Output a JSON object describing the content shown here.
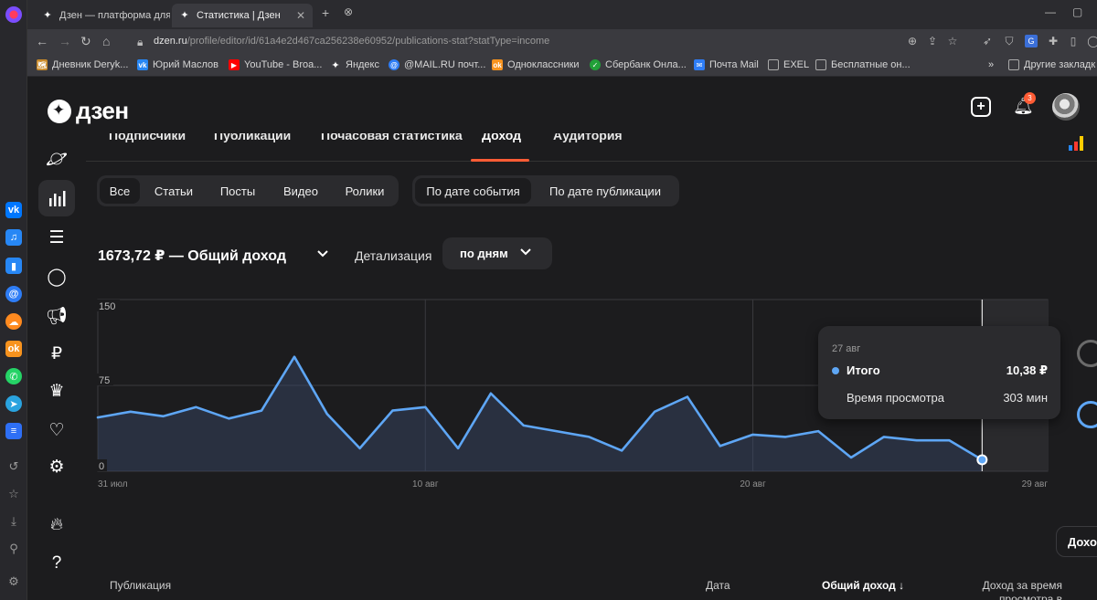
{
  "browser": {
    "tabs": [
      {
        "label": "Дзен — платформа для про",
        "active": false
      },
      {
        "label": "Статистика | Дзен",
        "active": true
      }
    ],
    "url": {
      "host": "dzen.ru",
      "path": "/profile/editor/id/61a4e2d467ca256238e60952/publications-stat?statType=income"
    },
    "bookmarks": [
      {
        "label": "Дневник Deryk...",
        "icon": "bookmark-diary-icon",
        "color": "#c98a2a"
      },
      {
        "label": "Юрий Маслов",
        "icon": "vk-icon",
        "color": "#2787f5"
      },
      {
        "label": "YouTube - Broa...",
        "icon": "youtube-icon",
        "color": "#ff0000"
      },
      {
        "label": "Яндекс",
        "icon": "yandex-icon",
        "color": "#fc3f1d"
      },
      {
        "label": "@MAIL.RU почт...",
        "icon": "mail-ru-icon",
        "color": "#2e7df6"
      },
      {
        "label": "Одноклассники",
        "icon": "ok-icon",
        "color": "#f7931e"
      },
      {
        "label": "Сбербанк Онла...",
        "icon": "sberbank-icon",
        "color": "#21a038"
      },
      {
        "label": "Почта Mail",
        "icon": "mail-icon",
        "color": "#2e7df6"
      },
      {
        "label": "EXEL",
        "icon": "folder-icon",
        "color": "#888888"
      },
      {
        "label": "Бесплатные он...",
        "icon": "folder-icon",
        "color": "#888888"
      }
    ],
    "bookmarks_overflow": "»",
    "other_bookmarks": "Другие закладк"
  },
  "header": {
    "logo_text": "дзен",
    "notification_count": "3"
  },
  "stat_tabs": [
    {
      "label": "Подписчики",
      "active": false
    },
    {
      "label": "Публикации",
      "active": false
    },
    {
      "label": "Почасовая статистика",
      "active": false
    },
    {
      "label": "Доход",
      "active": true
    },
    {
      "label": "Аудитория",
      "active": false
    }
  ],
  "content_filters": [
    {
      "label": "Все",
      "active": true
    },
    {
      "label": "Статьи",
      "active": false
    },
    {
      "label": "Посты",
      "active": false
    },
    {
      "label": "Видео",
      "active": false
    },
    {
      "label": "Ролики",
      "active": false
    }
  ],
  "date_filters": [
    {
      "label": "По дате события",
      "active": true
    },
    {
      "label": "По дате публикации",
      "active": false
    }
  ],
  "summary": {
    "total": "1673,72 ₽ — Общий доход",
    "detail_label": "Детализация",
    "detail_value": "по дням"
  },
  "chart_data": {
    "type": "area",
    "series": [
      {
        "values": [
          47,
          52,
          48,
          56,
          46,
          53,
          100,
          50,
          20,
          53,
          56,
          20,
          68,
          40,
          35,
          30,
          18,
          52,
          65,
          22,
          32,
          30,
          35,
          12,
          30,
          27,
          27,
          10
        ]
      }
    ],
    "x": [
      1,
      2,
      3,
      4,
      5,
      6,
      7,
      8,
      9,
      10,
      11,
      12,
      13,
      14,
      15,
      16,
      17,
      18,
      19,
      20,
      21,
      22,
      23,
      24,
      25,
      26,
      27,
      28
    ],
    "x_ticks": [
      {
        "x": 1,
        "label": "31 июл"
      },
      {
        "x": 11,
        "label": "10 авг"
      },
      {
        "x": 21,
        "label": "20 авг"
      },
      {
        "x": 30,
        "label": "29 авг"
      }
    ],
    "y_ticks": [
      {
        "y": 0,
        "label": "0"
      },
      {
        "y": 75,
        "label": "75"
      },
      {
        "y": 150,
        "label": "150"
      }
    ],
    "ylim": [
      0,
      150
    ],
    "xlim": [
      1,
      30
    ],
    "highlight_x": 28,
    "line_color": "#5ea6f5",
    "grid": true
  },
  "tooltip": {
    "date": "27 авг",
    "label": "Итого",
    "value": "10,38 ₽",
    "time_label": "Время просмотра",
    "time_value": "303 мин"
  },
  "income_chip": "Дохо",
  "table_header": {
    "publication": "Публикация",
    "date": "Дата",
    "total_income": "Общий доход ↓",
    "income_dzen": "Доход за время просмотра в Дзене"
  }
}
